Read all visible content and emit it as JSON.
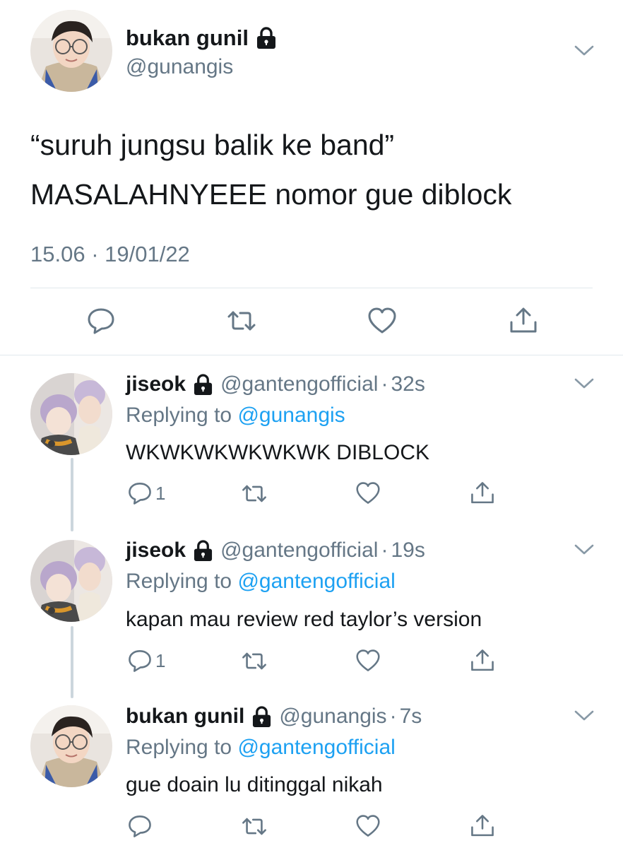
{
  "main_tweet": {
    "display_name": "bukan gunil",
    "handle": "@gunangis",
    "text_line1": "“suruh jungsu balik ke band”",
    "text_line2": "MASALAHNYEEE nomor gue diblock",
    "timestamp": "15.06 · 19/01/22",
    "icons": [
      "reply-icon",
      "retweet-icon",
      "like-icon",
      "share-icon"
    ]
  },
  "replies": [
    {
      "display_name": "jiseok",
      "handle": "@gantengofficial",
      "separator": "·",
      "age": "32s",
      "replying_prefix": "Replying to ",
      "replying_to": "@gunangis",
      "text": "WKWKWKWKWKWK DIBLOCK",
      "reply_count": "1"
    },
    {
      "display_name": "jiseok",
      "handle": "@gantengofficial",
      "separator": "·",
      "age": "19s",
      "replying_prefix": "Replying to ",
      "replying_to": "@gantengofficial",
      "text": "kapan mau review red taylor’s version",
      "reply_count": "1"
    },
    {
      "display_name": "bukan gunil",
      "handle": "@gunangis",
      "separator": "·",
      "age": "7s",
      "replying_prefix": "Replying to ",
      "replying_to": "@gantengofficial",
      "text": "gue doain lu ditinggal nikah",
      "reply_count": ""
    }
  ],
  "colors": {
    "text": "#14171a",
    "secondary": "#657786",
    "link": "#1da1f2",
    "divider": "#e1e8ed",
    "thread_line": "#ccd6dd"
  }
}
